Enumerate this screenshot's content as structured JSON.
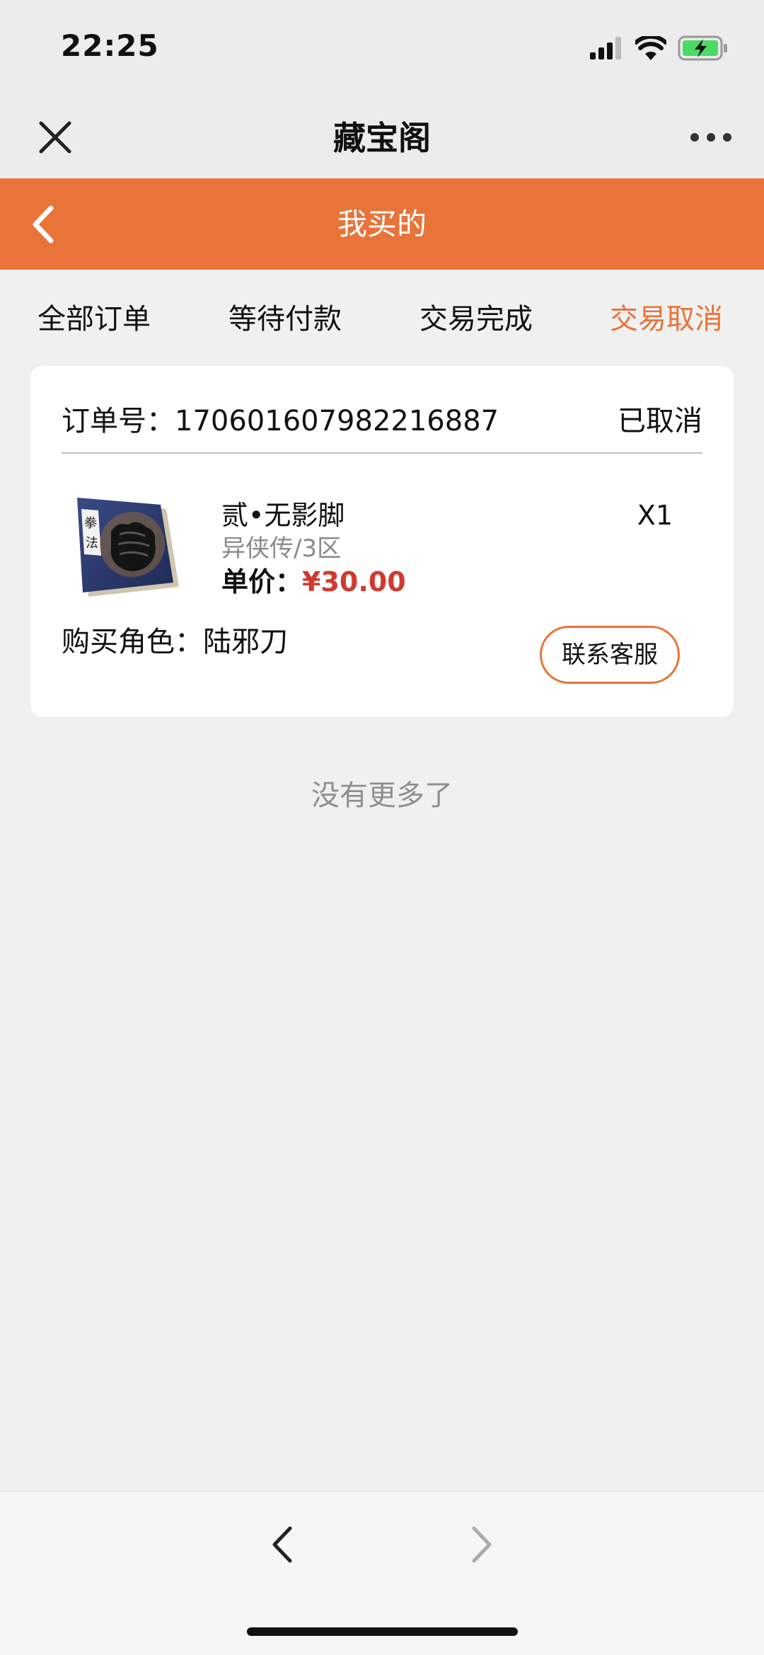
{
  "status_bar": {
    "time": "22:25",
    "icons": [
      "signal-icon",
      "wifi-icon",
      "battery-charging-icon"
    ]
  },
  "nav": {
    "title": "藏宝阁",
    "close_icon": "close-icon",
    "more_icon": "more-icon"
  },
  "header": {
    "title": "我买的",
    "back_icon": "chevron-left-icon",
    "bg_color": "#e8743a"
  },
  "tabs": [
    {
      "label": "全部订单",
      "active": false
    },
    {
      "label": "等待付款",
      "active": false
    },
    {
      "label": "交易完成",
      "active": false
    },
    {
      "label": "交易取消",
      "active": true
    }
  ],
  "order": {
    "number_label": "订单号：",
    "number": "170601607982216887",
    "status": "已取消",
    "item": {
      "name": "贰•无影脚",
      "server": "异侠传/3区",
      "price_label": "单价：",
      "price": "¥30.00",
      "quantity": "X1",
      "thumb_text": "拳法"
    },
    "buyer_label": "购买角色：",
    "buyer_name": "陆邪刀",
    "contact_button": "联系客服"
  },
  "footer_text": "没有更多了",
  "colors": {
    "accent": "#e8743a",
    "price": "#d03a2e",
    "muted": "#8f8f8f"
  }
}
